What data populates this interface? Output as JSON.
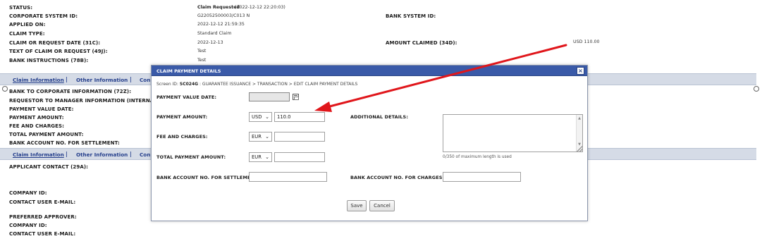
{
  "background": {
    "fields": [
      {
        "label": "STATUS:",
        "value": "Claim Requested",
        "extra": "(2022-12-12 22:20:03)"
      },
      {
        "label": "CORPORATE SYSTEM ID:",
        "value": "G22052500003/C013  N"
      },
      {
        "label": "APPLIED ON:",
        "value": "2022-12-12 21:59:35"
      },
      {
        "label": "CLAIM TYPE:",
        "value": "Standard Claim"
      },
      {
        "label": "CLAIM OR REQUEST DATE (31C):",
        "value": "2022-12-13"
      },
      {
        "label": "TEXT OF CLAIM OR REQUEST (49J):",
        "value": "Test"
      },
      {
        "label": "BANK INSTRUCTIONS (78B):",
        "value": "Test"
      }
    ],
    "right_fields": [
      {
        "label": "BANK SYSTEM ID:",
        "value": ""
      },
      {
        "label": "AMOUNT CLAIMED (34D):",
        "value": "USD  110.00"
      }
    ],
    "tabs1": [
      "Claim Information",
      "Other Information",
      "Con"
    ],
    "section1_fields": [
      "BANK TO CORPORATE INFORMATION (72Z):",
      "REQUESTOR TO MANAGER INFORMATION (INTERNAL)",
      "PAYMENT VALUE DATE:",
      "PAYMENT AMOUNT:",
      "FEE AND CHARGES:",
      "TOTAL PAYMENT AMOUNT:",
      "BANK ACCOUNT NO. FOR SETTLEMENT:"
    ],
    "tabs2": [
      "Claim Information",
      "Other Information",
      "Con"
    ],
    "section2_fields": [
      "APPLICANT CONTACT (29A):",
      "COMPANY ID:",
      "CONTACT USER E-MAIL:",
      "PREFERRED APPROVER:",
      "COMPANY ID:",
      "CONTACT USER E-MAIL:"
    ],
    "tab_separator": "|"
  },
  "modal": {
    "title": "CLAIM PAYMENT DETAILS",
    "close_glyph": "×",
    "screen_id_label": "Screen ID:",
    "screen_id": "SC024G",
    "breadcrumb": ": GUARANTEE ISSUANCE > TRANSACTION > EDIT CLAIM PAYMENT DETAILS",
    "payment_value_date_label": "PAYMENT VALUE DATE:",
    "payment_value_date": "",
    "payment_amount_label": "PAYMENT AMOUNT:",
    "payment_currency": "USD",
    "payment_amount": "110.0",
    "additional_details_label": "ADDITIONAL DETAILS:",
    "additional_details": "",
    "fee_label": "FEE AND CHARGES:",
    "fee_currency": "EUR",
    "fee_amount": "",
    "total_label": "TOTAL PAYMENT AMOUNT:",
    "total_currency": "EUR",
    "total_amount": "",
    "char_hint": "0/350 of maximum length is used",
    "settlement_label": "BANK ACCOUNT NO. FOR SETTLEMENT:",
    "settlement_value": "",
    "charges_label": "BANK ACCOUNT NO. FOR CHARGES:",
    "charges_value": "",
    "save_label": "Save",
    "cancel_label": "Cancel"
  },
  "colors": {
    "modal_header": "#3a5aa8",
    "tab_text": "#253f8c",
    "annotation_arrow": "#e0161b"
  }
}
